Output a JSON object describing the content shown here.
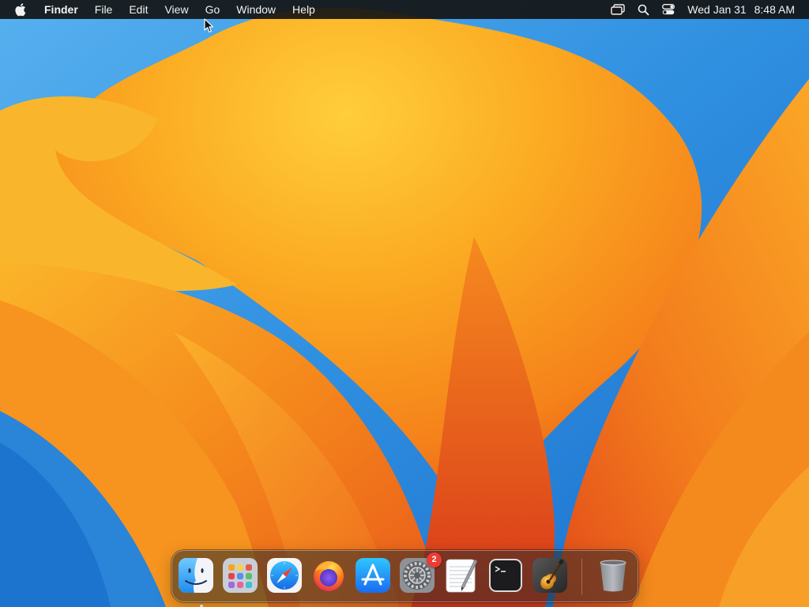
{
  "menubar": {
    "apple_icon": "apple-logo-icon",
    "app_name": "Finder",
    "menus": [
      "File",
      "Edit",
      "View",
      "Go",
      "Window",
      "Help"
    ],
    "status_icons": [
      "screen-mirroring-icon",
      "spotlight-search-icon",
      "control-center-icon"
    ],
    "clock": {
      "date": "Wed Jan 31",
      "time": "8:48 AM"
    }
  },
  "dock": {
    "apps": [
      {
        "name": "Finder",
        "icon": "finder-icon",
        "running": true
      },
      {
        "name": "Launchpad",
        "icon": "launchpad-icon",
        "running": false
      },
      {
        "name": "Safari",
        "icon": "safari-icon",
        "running": false
      },
      {
        "name": "Firefox",
        "icon": "firefox-icon",
        "running": false
      },
      {
        "name": "App Store",
        "icon": "app-store-icon",
        "running": false
      },
      {
        "name": "System Settings",
        "icon": "system-settings-icon",
        "running": false,
        "badge": "2"
      },
      {
        "name": "TextEdit",
        "icon": "textedit-icon",
        "running": false
      },
      {
        "name": "Terminal",
        "icon": "terminal-icon",
        "running": false
      },
      {
        "name": "GarageBand",
        "icon": "garageband-icon",
        "running": false
      }
    ],
    "trash": {
      "name": "Trash",
      "icon": "trash-icon"
    }
  },
  "colors": {
    "menubar_bg": "#141414",
    "wallpaper_sky": "#2f8fe0",
    "wallpaper_orange": "#f79a1e",
    "wallpaper_red": "#e2461c",
    "badge_red": "#ee3b33"
  }
}
